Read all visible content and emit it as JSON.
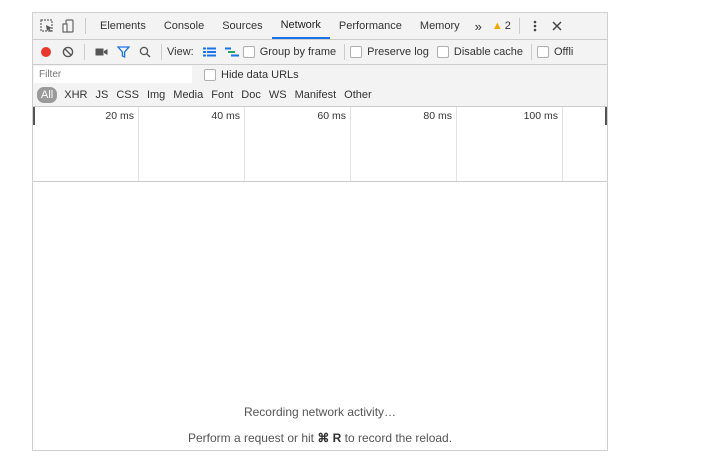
{
  "tabs": [
    {
      "label": "Elements"
    },
    {
      "label": "Console"
    },
    {
      "label": "Sources"
    },
    {
      "label": "Network",
      "active": true
    },
    {
      "label": "Performance"
    },
    {
      "label": "Memory"
    }
  ],
  "tabbar": {
    "overflow_label": "»",
    "warning_count": "2"
  },
  "toolbar": {
    "view_label": "View:",
    "group_by_frame": "Group by frame",
    "preserve_log": "Preserve log",
    "disable_cache": "Disable cache",
    "offline": "Offli"
  },
  "filter": {
    "placeholder": "Filter",
    "hide_data_urls": "Hide data URLs"
  },
  "types": [
    "All",
    "XHR",
    "JS",
    "CSS",
    "Img",
    "Media",
    "Font",
    "Doc",
    "WS",
    "Manifest",
    "Other"
  ],
  "timeline": {
    "ticks": [
      "20 ms",
      "40 ms",
      "60 ms",
      "80 ms",
      "100 ms"
    ]
  },
  "empty": {
    "recording": "Recording network activity…",
    "hint_pre": "Perform a request or hit ",
    "hint_key": "⌘ R",
    "hint_post": " to record the reload."
  },
  "colors": {
    "record": "#e8382e",
    "accent": "#1a73e8",
    "warning": "#f2a600",
    "filter_icon": "#1a73e8"
  },
  "icons": {
    "inspect": "inspect-element-icon",
    "device": "device-toolbar-icon",
    "record": "record-icon",
    "clear": "clear-icon",
    "video": "screenshot-camera-icon",
    "filter": "filter-funnel-icon",
    "search": "search-icon",
    "list_view": "large-rows-icon",
    "waterfall": "waterfall-overview-icon",
    "menu": "kebab-menu-icon",
    "close": "close-icon"
  }
}
